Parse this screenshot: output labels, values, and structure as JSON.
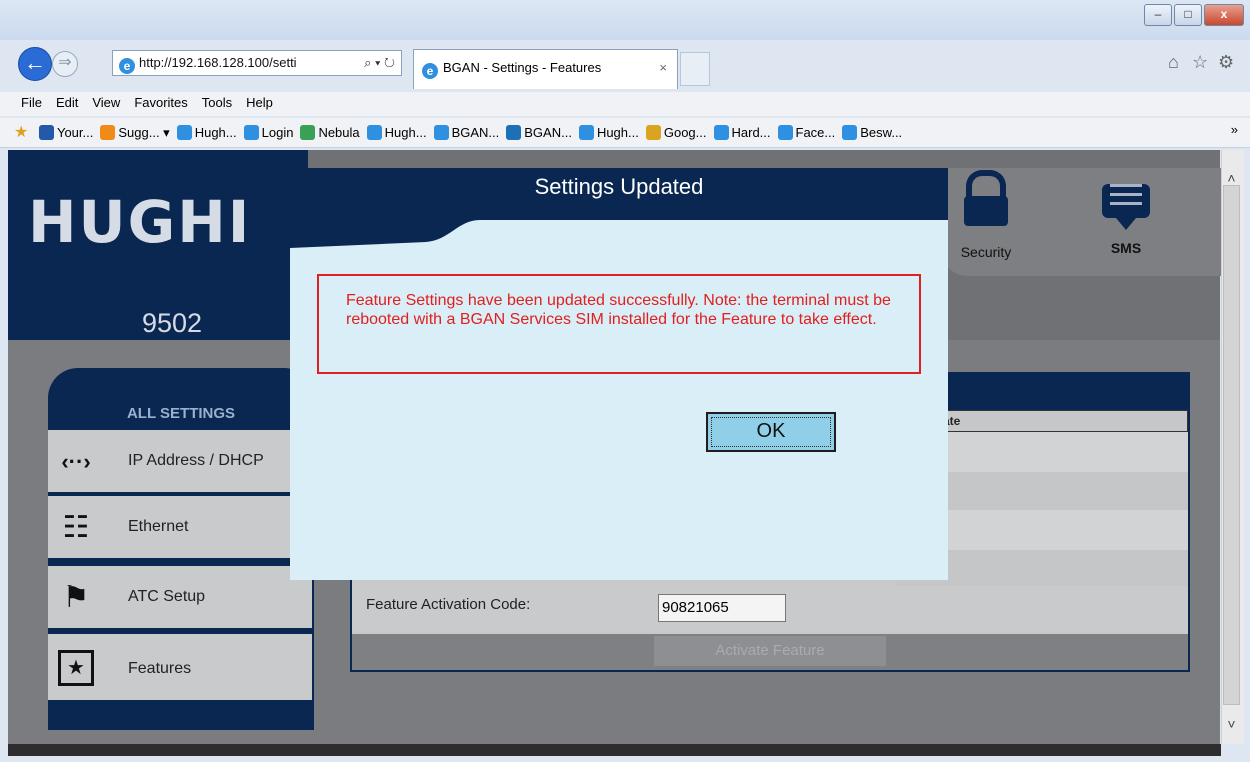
{
  "browser": {
    "address_url": "http://192.168.128.100/setti",
    "address_controls": "⌕ ▾ ↻",
    "tab_title": "BGAN - Settings - Features",
    "tab_close": "×",
    "window_buttons": {
      "minimize": "–",
      "maximize": "□",
      "close": "x"
    },
    "top_icons": [
      "home-icon",
      "star-icon",
      "gear-icon"
    ]
  },
  "menu": [
    "File",
    "Edit",
    "View",
    "Favorites",
    "Tools",
    "Help"
  ],
  "favorites": [
    {
      "label": "Your...",
      "icon": "b-icon",
      "color": "#2458a8"
    },
    {
      "label": "Sugg... ▾",
      "icon": "suggested-icon",
      "color": "#f08a18"
    },
    {
      "label": "Hugh...",
      "icon": "ie-page-icon",
      "color": "#2f8fe0"
    },
    {
      "label": "Login",
      "icon": "ie-page-icon",
      "color": "#2f8fe0"
    },
    {
      "label": "Nebula",
      "icon": "nebula-icon",
      "color": "#3aa055"
    },
    {
      "label": "Hugh...",
      "icon": "ie-page-icon",
      "color": "#2f8fe0"
    },
    {
      "label": "BGAN...",
      "icon": "ie-page-icon",
      "color": "#2f8fe0"
    },
    {
      "label": "BGAN...",
      "icon": "globe-icon",
      "color": "#1d6fb8"
    },
    {
      "label": "Hugh...",
      "icon": "ie-page-icon",
      "color": "#2f8fe0"
    },
    {
      "label": "Goog...",
      "icon": "maps-icon",
      "color": "#d9a520"
    },
    {
      "label": "Hard...",
      "icon": "ie-page-icon",
      "color": "#2f8fe0"
    },
    {
      "label": "Face...",
      "icon": "ie-page-icon",
      "color": "#2f8fe0"
    },
    {
      "label": "Besw...",
      "icon": "ie-page-icon",
      "color": "#2f8fe0"
    }
  ],
  "favorites_more": "»",
  "page": {
    "brand": "HUGHI",
    "model": "9502",
    "top_buttons": [
      {
        "label": "Security",
        "icon": "lock-icon"
      },
      {
        "label": "SMS",
        "icon": "chat-bubble-icon"
      }
    ],
    "nav_header": "ALL SETTINGS",
    "nav_items": [
      {
        "label": "IP Address / DHCP",
        "icon": "arrows-icon",
        "glyph": "‹··›"
      },
      {
        "label": "Ethernet",
        "icon": "network-icon",
        "glyph": "☷"
      },
      {
        "label": "ATC Setup",
        "icon": "antenna-icon",
        "glyph": "⚑"
      },
      {
        "label": "Features",
        "icon": "puzzle-star-icon",
        "glyph": "★"
      }
    ],
    "table_col_fragment": "ate",
    "feature_code_label": "Feature Activation Code:",
    "feature_code_value": "90821065",
    "activate_button": "Activate Feature"
  },
  "modal": {
    "title": "Settings Updated",
    "message": "Feature Settings have been updated successfully. Note: the terminal must be rebooted with a BGAN Services SIM installed for the Feature to take effect.",
    "ok_label": "OK"
  },
  "colors": {
    "navy": "#0a2752",
    "error_red": "#e0201e",
    "modal_bg": "#daeef7",
    "ok_button": "#8fd0e8"
  }
}
